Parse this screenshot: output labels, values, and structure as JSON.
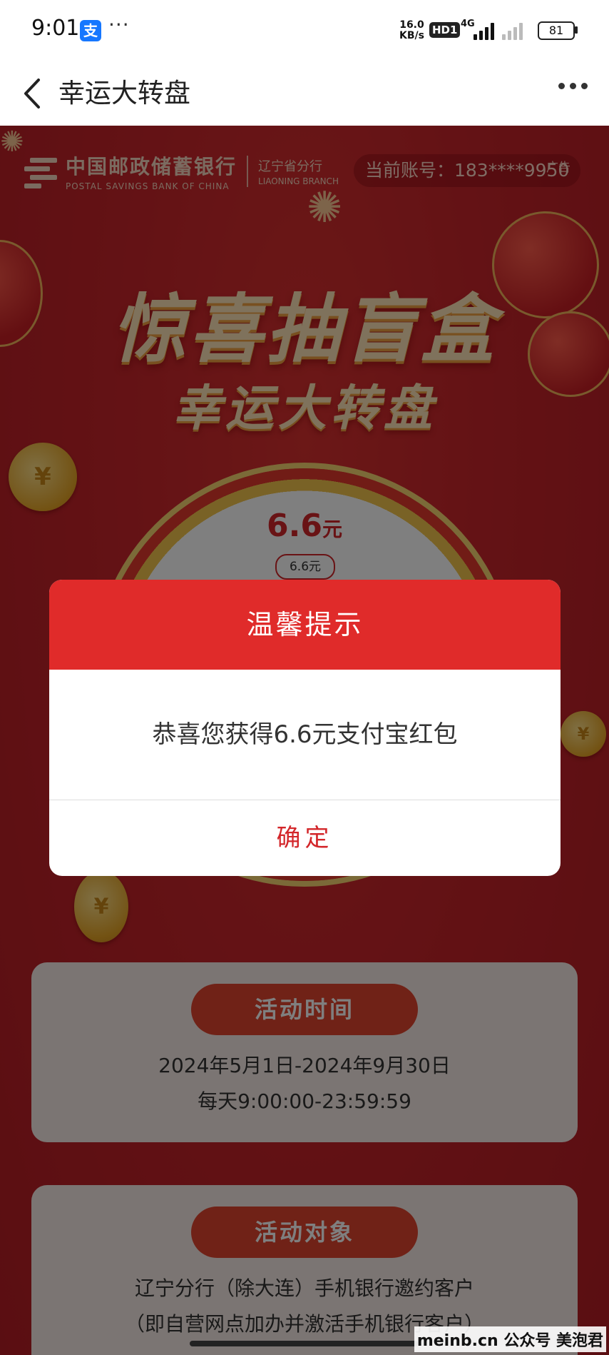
{
  "status_bar": {
    "time": "9:01",
    "app_icon_label": "支",
    "more": "···",
    "net_speed_value": "16.0",
    "net_speed_unit": "KB/s",
    "hd_badge": "HD1",
    "network_type": "4G",
    "battery": "81"
  },
  "nav": {
    "title": "幸运大转盘"
  },
  "banner": {
    "bank_name_cn": "中国邮政储蓄银行",
    "bank_name_en": "POSTAL SAVINGS BANK OF CHINA",
    "branch_cn": "辽宁省分行",
    "branch_en": "LIAONING BRANCH",
    "account": "当前账号：183****9950",
    "ad_tag": "广告",
    "title_line1": "惊喜抽盲盒",
    "title_line2": "幸运大转盘",
    "wheel_prize_value": "6.6",
    "wheel_prize_unit": "元",
    "wheel_chip": "6.6元"
  },
  "activity_time": {
    "pill": "活动时间",
    "line1": "2024年5月1日-2024年9月30日",
    "line2": "每天9:00:00-23:59:59"
  },
  "activity_target": {
    "pill": "活动对象",
    "line1": "辽宁分行（除大连）手机银行邀约客户",
    "line2": "（即自营网点加办并激活手机银行客户）"
  },
  "modal": {
    "title": "温馨提示",
    "message": "恭喜您获得6.6元支付宝红包",
    "confirm": "确定"
  },
  "watermark": "meinb.cn 公众号 美泡君",
  "colors": {
    "brand_red": "#e02b2a",
    "promo_bg": "#c7242a",
    "gold": "#f3c44d"
  }
}
